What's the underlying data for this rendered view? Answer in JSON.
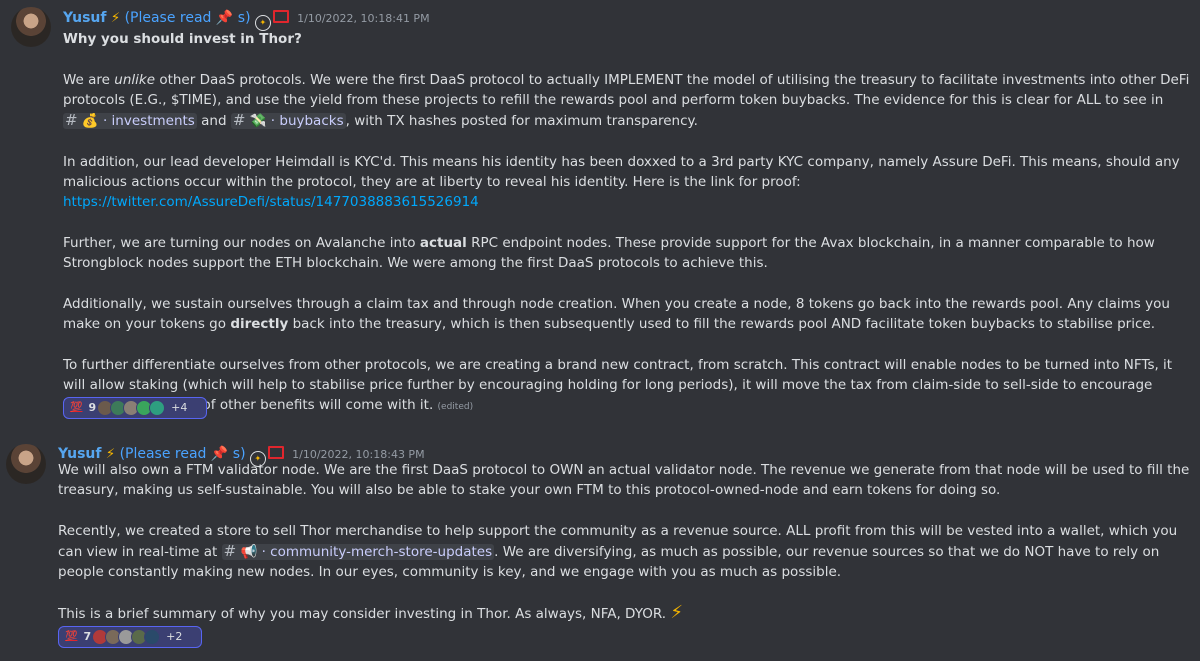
{
  "messages": [
    {
      "username": "Yusuf",
      "bolt": "⚡",
      "role_prefix": "(Please read",
      "pin": "📌",
      "role_suffix": "s)",
      "timestamp": "1/10/2022, 10:18:41 PM",
      "title": "Why you should invest in Thor?",
      "p1": {
        "a": "We are ",
        "b": "unlike",
        "c": " other DaaS protocols. We were the first DaaS protocol to actually IMPLEMENT the model of utilising the treasury to facilitate investments into other DeFi protocols (E.G., $TIME), and use the yield from these projects to refill the rewards pool and perform token buybacks. The evidence for this is clear for ALL to see in ",
        "mention1": "💰 · investments",
        "and": " and ",
        "mention2": "💸 · buybacks",
        "d": ", with TX hashes posted for maximum transparency."
      },
      "p2": {
        "a": "In addition, our lead developer Heimdall is KYC'd. This means his identity has been doxxed to a 3rd party KYC company, namely Assure DeFi. This means, should any malicious actions occur within the protocol, they are at liberty to reveal his identity. Here is the link for proof: ",
        "link": "https://twitter.com/AssureDefi/status/1477038883615526914"
      },
      "p3": {
        "a": "Further, we are turning our nodes on Avalanche into ",
        "b": "actual",
        "c": " RPC endpoint nodes. These provide support for the Avax blockchain, in a manner comparable to how Strongblock nodes support the ETH blockchain. We were among the first DaaS protocols to achieve this."
      },
      "p4": {
        "a": "Additionally, we sustain ourselves through a claim tax and through node creation. When you create a node, 8 tokens go back into the rewards pool. Any claims you make on your tokens go ",
        "b": "directly",
        "c": " back into the treasury, which is then subsequently used to fill the rewards pool AND facilitate token buybacks to stabilise price."
      },
      "p5": {
        "a": "To further differentiate ourselves from other protocols, we are creating a brand new contract, from scratch. This contract will enable nodes to be turned into NFTs, it will allow staking (which will help to stabilise price further by encouraging holding for long periods), it will move the tax from claim-side to sell-side to encourage HODLing and a host of other benefits will come with it. ",
        "edited": "(edited)"
      },
      "reaction": {
        "emoji": "💯",
        "count": "9",
        "more": "+4"
      }
    },
    {
      "username": "Yusuf",
      "bolt": "⚡",
      "role_prefix": "(Please read",
      "pin": "📌",
      "role_suffix": "s)",
      "timestamp": "1/10/2022, 10:18:43 PM",
      "p1": "We will also own a FTM validator node. We are the first DaaS protocol to OWN an actual validator node. The revenue we generate from that node will be used to fill the treasury, making us self-sustainable. You will also be able to stake your own FTM to this protocol-owned-node and earn tokens for doing so.",
      "p2": {
        "a": "Recently, we created a store to sell Thor merchandise to help support the community as a revenue source. ALL profit from this will be vested into a wallet, which you can view in real-time at ",
        "mention": "📢 · community-merch-store-updates",
        "b": ". We are diversifying, as much as possible, our revenue sources so that we do NOT have to rely on people constantly making new nodes. In our eyes, community is key, and we engage with you as much as possible."
      },
      "p3": "This is a brief summary of why you may consider investing in Thor. As always, NFA, DYOR. ",
      "p3_bolt": "⚡",
      "reaction": {
        "emoji": "💯",
        "count": "7",
        "more": "+2"
      }
    }
  ],
  "colors": {
    "background": "#313338",
    "username": "#56a6f0",
    "role": "#4aa3ff",
    "link": "#00a8fc",
    "reaction_border": "#5865f2"
  }
}
